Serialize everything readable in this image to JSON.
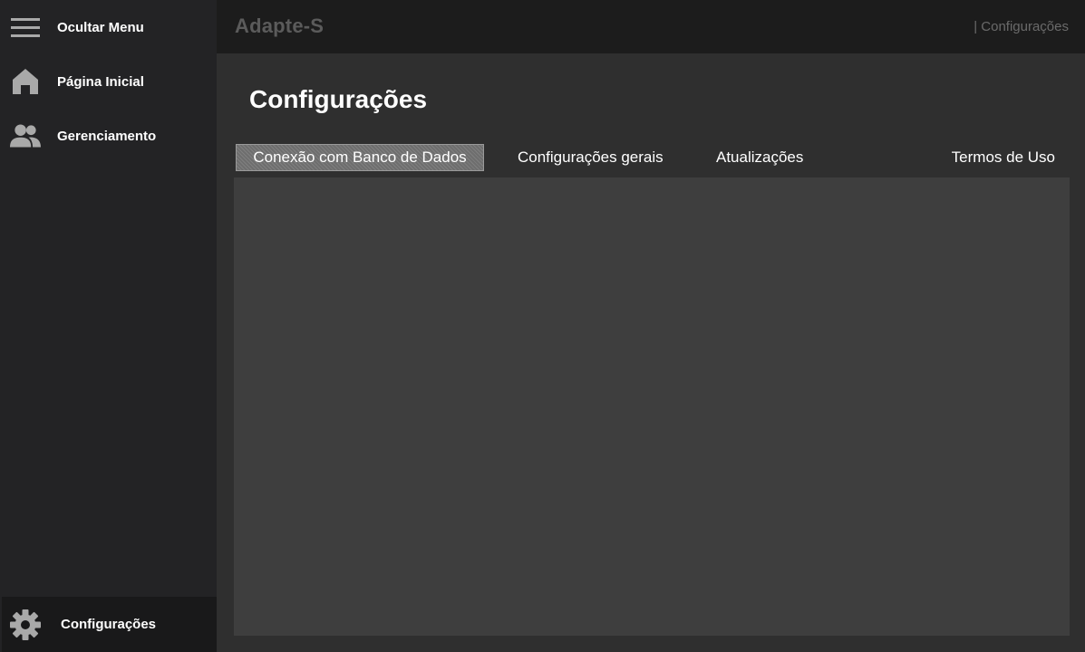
{
  "sidebar": {
    "items": [
      {
        "label": "Ocultar Menu",
        "icon": "hamburger-menu-icon"
      },
      {
        "label": "Página Inicial",
        "icon": "home-icon"
      },
      {
        "label": "Gerenciamento",
        "icon": "users-icon"
      },
      {
        "label": "Configurações",
        "icon": "gear-icon"
      }
    ]
  },
  "header": {
    "app_title": "Adapte-S",
    "breadcrumb": "| Configurações"
  },
  "main": {
    "title": "Configurações",
    "tabs": [
      {
        "label": "Conexão com Banco de Dados",
        "selected": true
      },
      {
        "label": "Configurações gerais",
        "selected": false
      },
      {
        "label": "Atualizações",
        "selected": false
      },
      {
        "label": "Termos de Uso",
        "selected": false
      }
    ]
  },
  "colors": {
    "sidebar_bg": "#232325",
    "header_bg": "#1c1c1c",
    "page_bg": "#2f2f2f",
    "panel_bg": "#3e3e3e",
    "icon_gray": "#a9a9a9"
  }
}
